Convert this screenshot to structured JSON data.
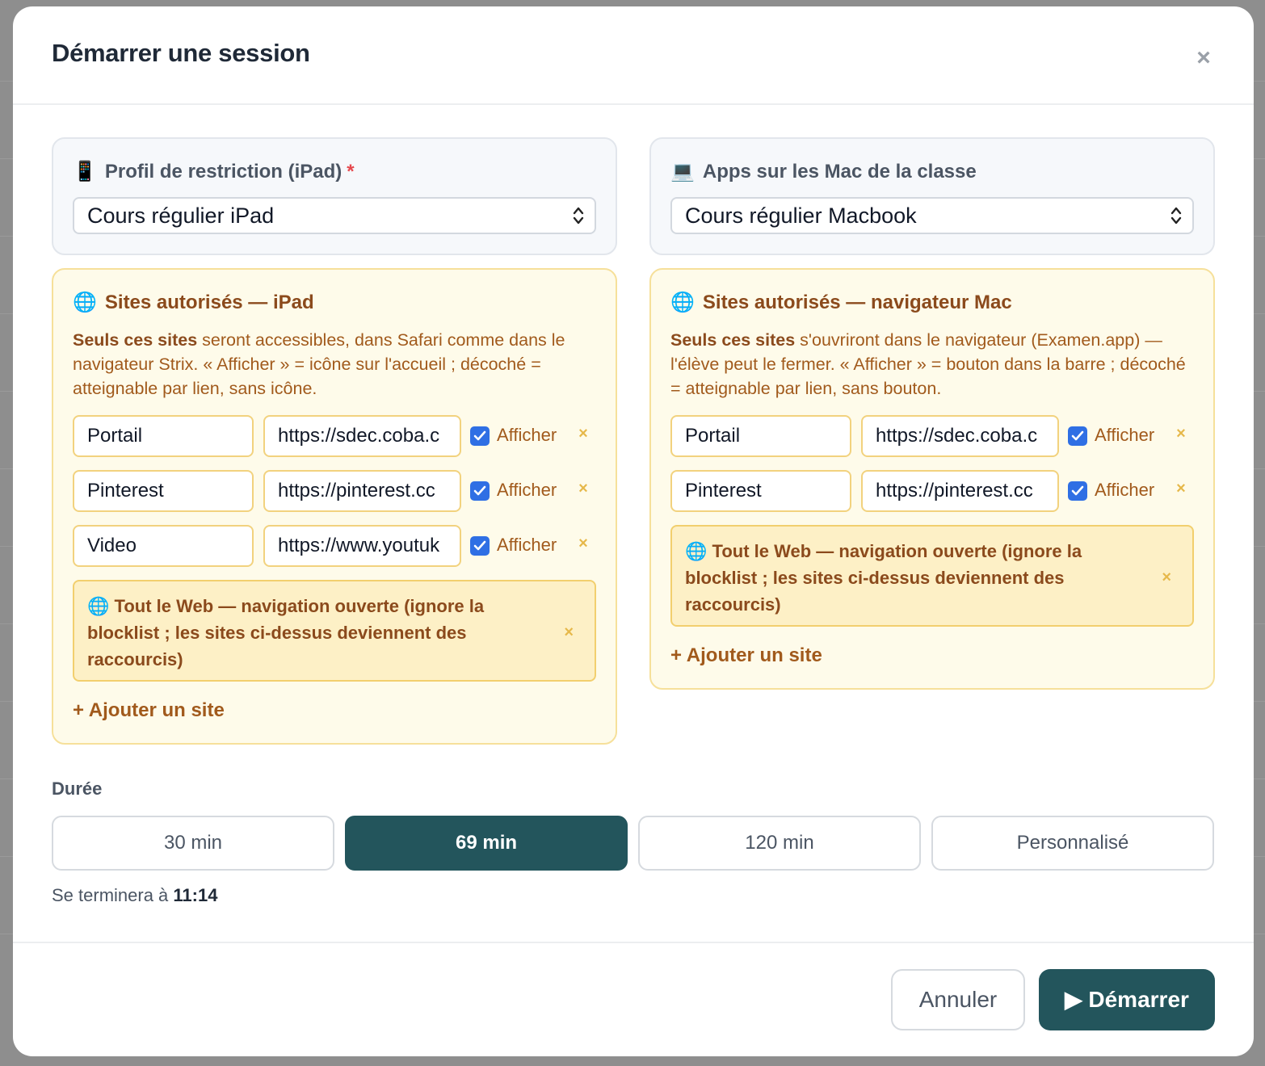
{
  "modal": {
    "title": "Démarrer une session",
    "close_label": "×"
  },
  "ipad_profile": {
    "icon": "📱",
    "label": "Profil de restriction (iPad)",
    "required_mark": "*",
    "selected": "Cours régulier iPad"
  },
  "mac_apps": {
    "icon": "💻",
    "label": "Apps sur les Mac de la classe",
    "selected": "Cours régulier Macbook"
  },
  "ipad_sites": {
    "icon": "🌐",
    "title": "Sites autorisés — iPad",
    "desc_bold": "Seuls ces sites",
    "desc_rest": " seront accessibles, dans Safari comme dans le navigateur Strix. « Afficher » = icône sur l'accueil ; décoché = atteignable par lien, sans icône.",
    "rows": [
      {
        "name": "Portail",
        "url": "https://sdec.coba.c",
        "show_label": "Afficher",
        "checked": true
      },
      {
        "name": "Pinterest",
        "url": "https://pinterest.cc",
        "show_label": "Afficher",
        "checked": true
      },
      {
        "name": "Video",
        "url": "https://www.youtuk",
        "show_label": "Afficher",
        "checked": true
      }
    ],
    "open_web": "Tout le Web — navigation ouverte (ignore la blocklist ; les sites ci-dessus deviennent des raccourcis)",
    "add_label": "+ Ajouter un site"
  },
  "mac_sites": {
    "icon": "🌐",
    "title": "Sites autorisés — navigateur Mac",
    "desc_bold": "Seuls ces sites",
    "desc_rest": " s'ouvriront dans le navigateur (Examen.app) — l'élève peut le fermer. « Afficher » = bouton dans la barre ; décoché = atteignable par lien, sans bouton.",
    "rows": [
      {
        "name": "Portail",
        "url": "https://sdec.coba.c",
        "show_label": "Afficher",
        "checked": true
      },
      {
        "name": "Pinterest",
        "url": "https://pinterest.cc",
        "show_label": "Afficher",
        "checked": true
      }
    ],
    "open_web": "Tout le Web — navigation ouverte (ignore la blocklist ; les sites ci-dessus deviennent des raccourcis)",
    "add_label": "+ Ajouter un site"
  },
  "duration": {
    "label": "Durée",
    "options": [
      "30 min",
      "69 min",
      "120 min",
      "Personnalisé"
    ],
    "selected_index": 1,
    "end_prefix": "Se terminera à ",
    "end_time": "11:14"
  },
  "footer": {
    "cancel_label": "Annuler",
    "start_label": "▶ Démarrer"
  },
  "colors": {
    "accent": "#23555c",
    "sites_bg": "#fefbea",
    "sites_text": "#a15a1c",
    "checkbox": "#2f6fe4"
  }
}
